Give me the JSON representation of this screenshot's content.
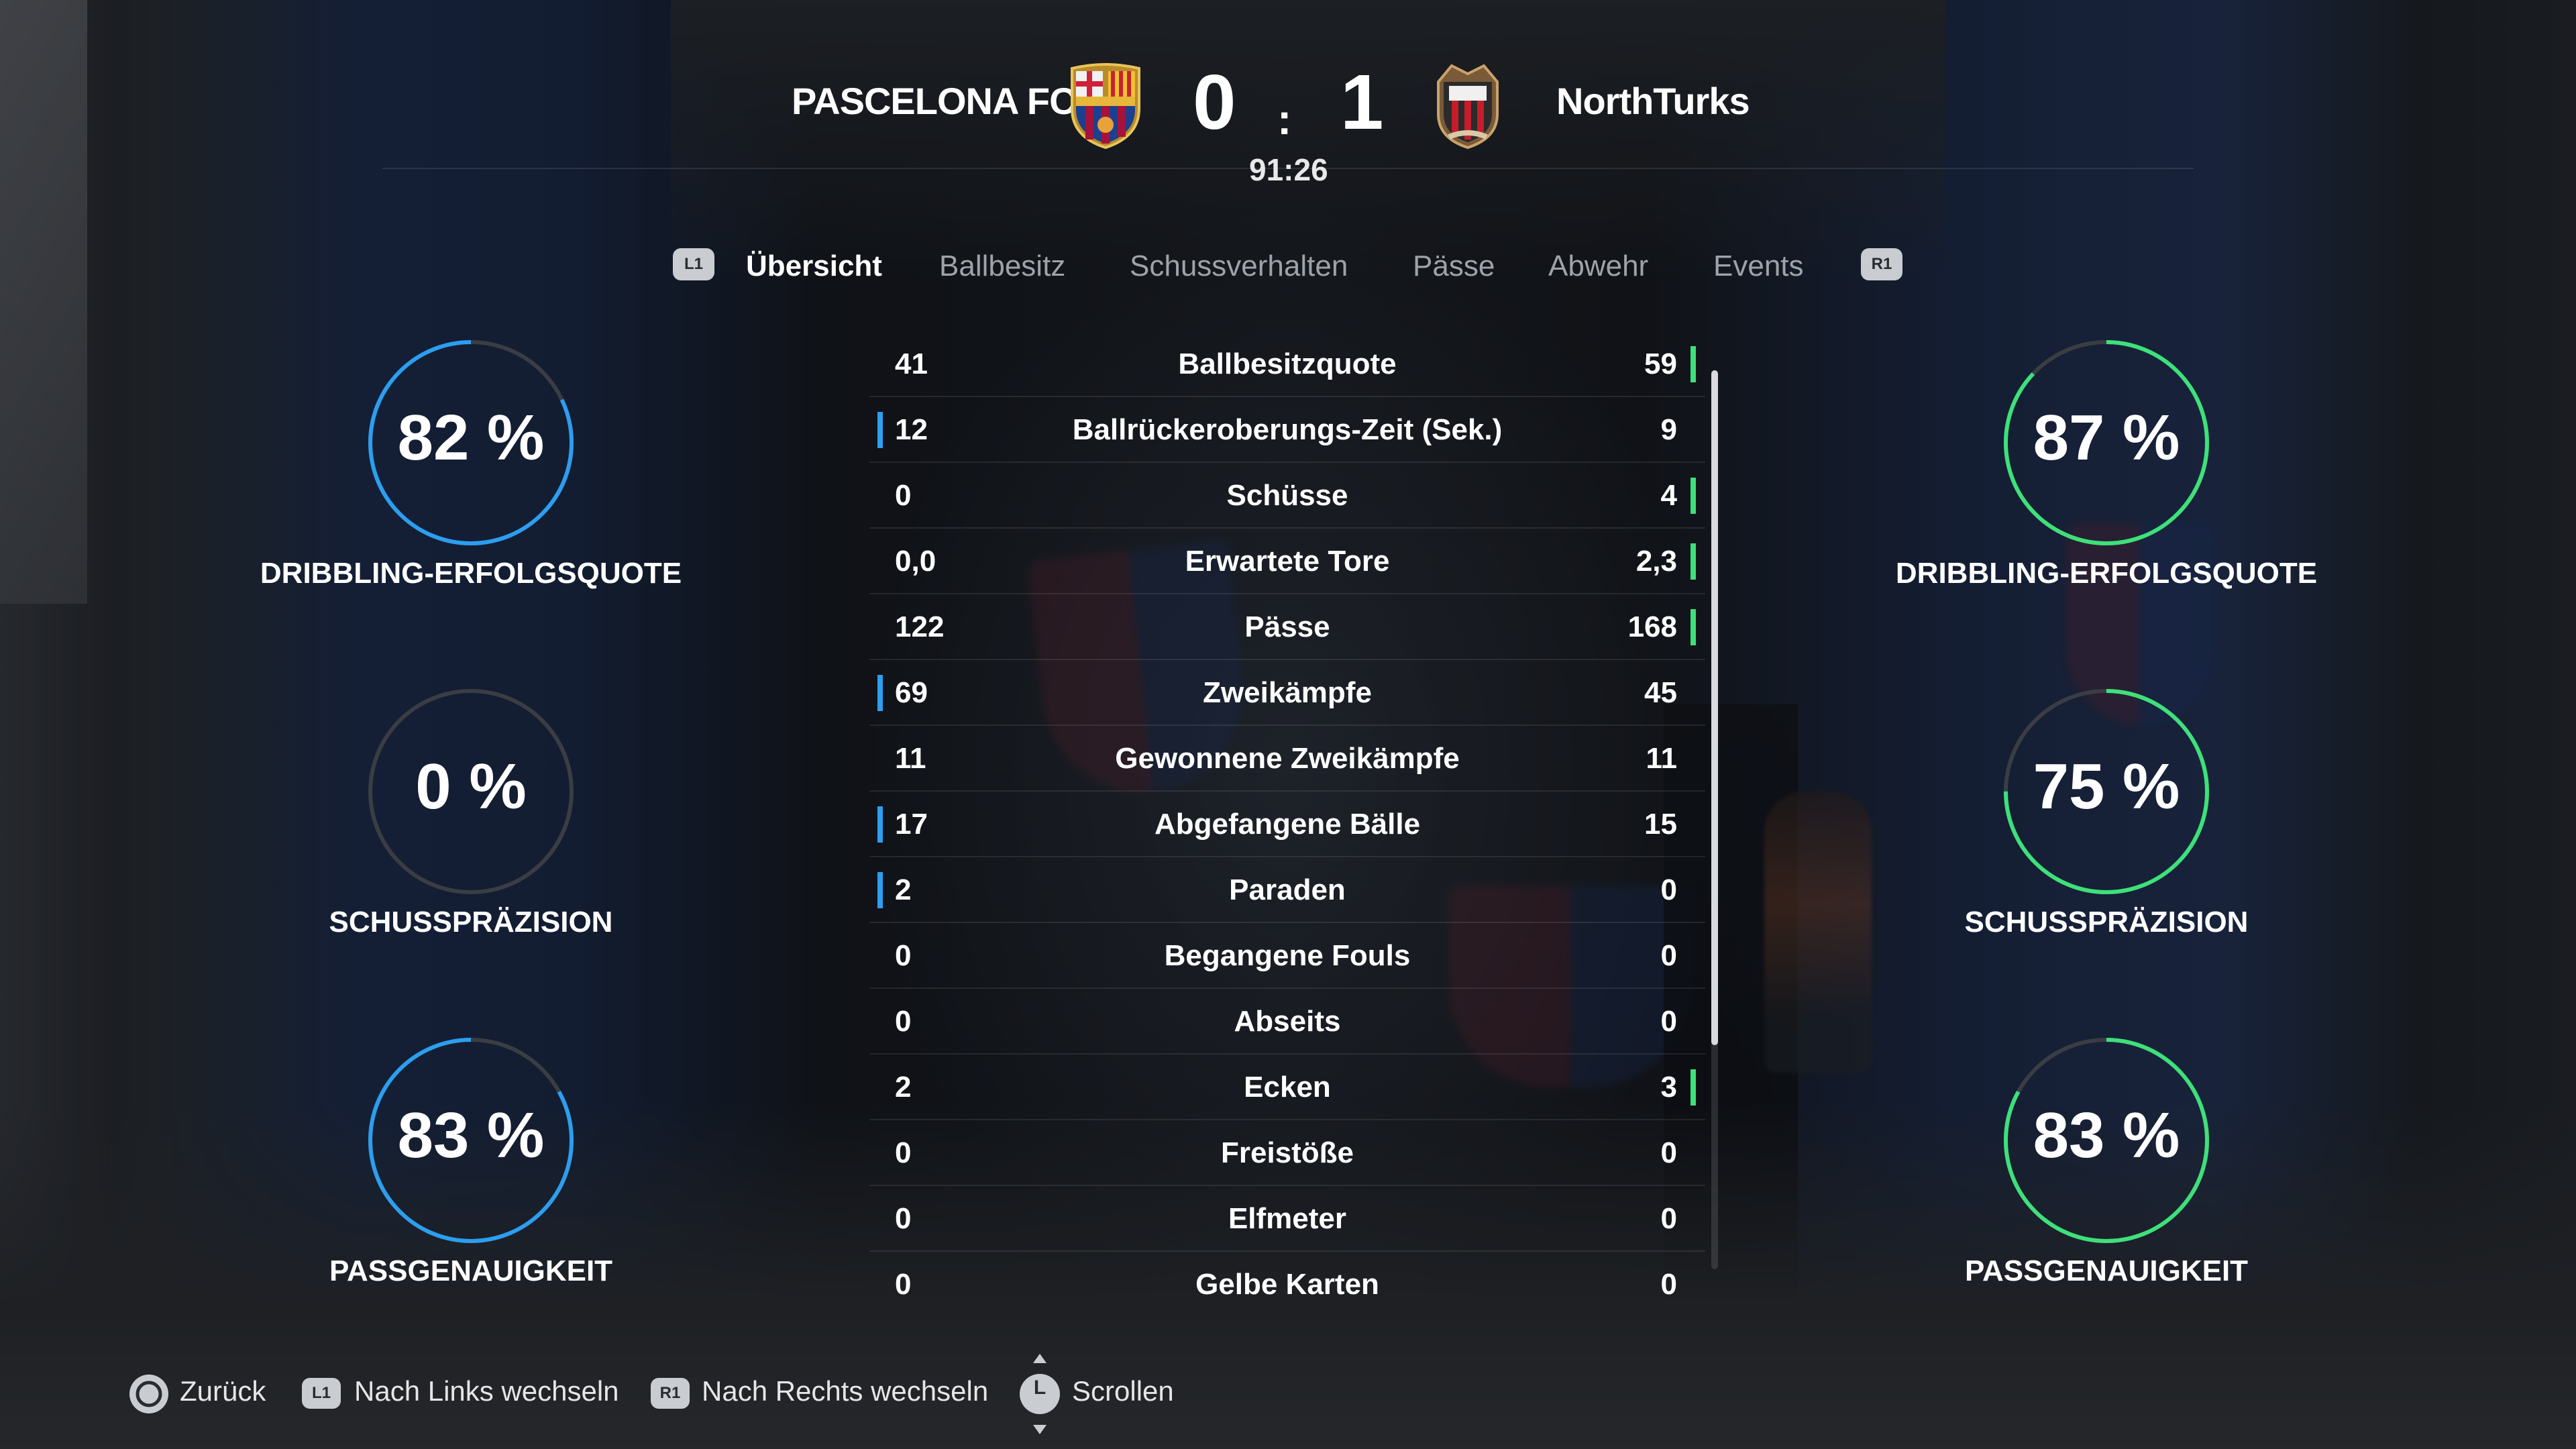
{
  "match": {
    "home_team": "PASCELONA FC",
    "away_team": "NorthTurks",
    "home_score": "0",
    "separator": ":",
    "away_score": "1",
    "clock": "91:26"
  },
  "colors": {
    "home": "#2c9ef0",
    "away": "#3ee07a",
    "ring_track": "#3a3d42"
  },
  "tabs": {
    "left_button": "L1",
    "right_button": "R1",
    "items": [
      {
        "label": "Übersicht",
        "active": true
      },
      {
        "label": "Ballbesitz",
        "active": false
      },
      {
        "label": "Schussverhalten",
        "active": false
      },
      {
        "label": "Pässe",
        "active": false
      },
      {
        "label": "Abwehr",
        "active": false
      },
      {
        "label": "Events",
        "active": false
      }
    ]
  },
  "stats": [
    {
      "label": "Ballbesitzquote",
      "home": "41",
      "away": "59",
      "leader": "away"
    },
    {
      "label": "Ballrückeroberungs-Zeit (Sek.)",
      "home": "12",
      "away": "9",
      "leader": "home"
    },
    {
      "label": "Schüsse",
      "home": "0",
      "away": "4",
      "leader": "away"
    },
    {
      "label": "Erwartete Tore",
      "home": "0,0",
      "away": "2,3",
      "leader": "away"
    },
    {
      "label": "Pässe",
      "home": "122",
      "away": "168",
      "leader": "away"
    },
    {
      "label": "Zweikämpfe",
      "home": "69",
      "away": "45",
      "leader": "home"
    },
    {
      "label": "Gewonnene Zweikämpfe",
      "home": "11",
      "away": "11",
      "leader": "none"
    },
    {
      "label": "Abgefangene Bälle",
      "home": "17",
      "away": "15",
      "leader": "home"
    },
    {
      "label": "Paraden",
      "home": "2",
      "away": "0",
      "leader": "home"
    },
    {
      "label": "Begangene Fouls",
      "home": "0",
      "away": "0",
      "leader": "none"
    },
    {
      "label": "Abseits",
      "home": "0",
      "away": "0",
      "leader": "none"
    },
    {
      "label": "Ecken",
      "home": "2",
      "away": "3",
      "leader": "away"
    },
    {
      "label": "Freistöße",
      "home": "0",
      "away": "0",
      "leader": "none"
    },
    {
      "label": "Elfmeter",
      "home": "0",
      "away": "0",
      "leader": "none"
    },
    {
      "label": "Gelbe Karten",
      "home": "0",
      "away": "0",
      "leader": "none"
    }
  ],
  "rings": {
    "home": [
      {
        "value_text": "82 %",
        "fraction": 0.82,
        "label": "DRIBBLING-ERFOLGSQUOTE"
      },
      {
        "value_text": "0 %",
        "fraction": 0.0,
        "label": "SCHUSSPRÄZISION"
      },
      {
        "value_text": "83 %",
        "fraction": 0.83,
        "label": "PASSGENAUIGKEIT"
      }
    ],
    "away": [
      {
        "value_text": "87 %",
        "fraction": 0.87,
        "label": "DRIBBLING-ERFOLGSQUOTE"
      },
      {
        "value_text": "75 %",
        "fraction": 0.75,
        "label": "SCHUSSPRÄZISION"
      },
      {
        "value_text": "83 %",
        "fraction": 0.83,
        "label": "PASSGENAUIGKEIT"
      }
    ]
  },
  "footer": {
    "back": {
      "icon": "circle-button-icon",
      "label": "Zurück"
    },
    "left": {
      "button": "L1",
      "label": "Nach Links wechseln"
    },
    "right": {
      "button": "R1",
      "label": "Nach Rechts wechseln"
    },
    "scroll": {
      "button": "L",
      "label": "Scrollen"
    }
  }
}
